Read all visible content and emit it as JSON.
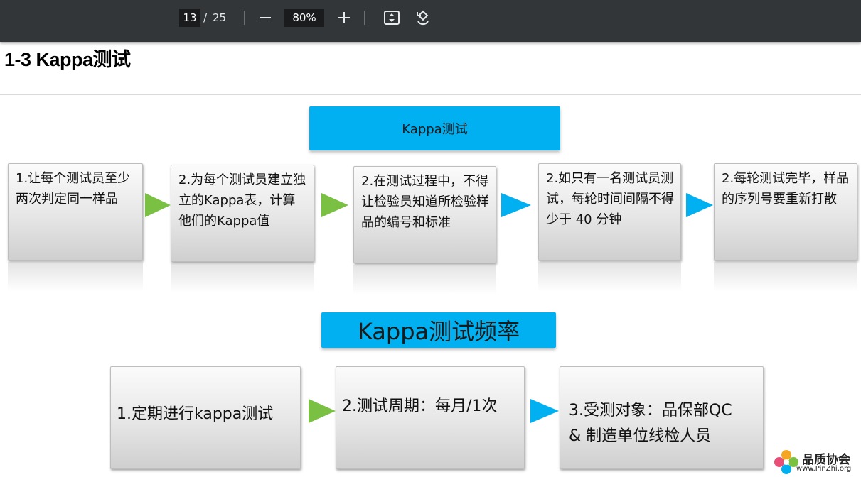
{
  "toolbar": {
    "current_page": "13",
    "separator": "/",
    "total_pages": "25",
    "zoom": "80%",
    "icons": [
      "minus-icon",
      "plus-icon",
      "fit-page-icon",
      "rotate-icon"
    ]
  },
  "slide": {
    "title": "1-3 Kappa测试",
    "section1": {
      "header": "Kappa测试",
      "steps": [
        "1.让每个测试员至少两次判定同一样品",
        "2.为每个测试员建立独立的Kappa表，计算他们的Kappa值",
        "2.在测试过程中，不得让检验员知道所检验样品的编号和标准",
        "2.如只有一名测试员测试，每轮时间间隔不得少于 40 分钟",
        "2.每轮测试完毕，样品的序列号要重新打散"
      ]
    },
    "section2": {
      "header": "Kappa测试频率",
      "steps": [
        "1.定期进行kappa测试",
        "2.测试周期：每月/1次",
        "3.受测对象：品保部QC & 制造单位线检人员"
      ]
    },
    "colors": {
      "header_blue": "#00b0f0",
      "arrow_green": "#7ac143",
      "arrow_blue": "#00b0f0"
    }
  },
  "watermark": {
    "name": "品质协会",
    "url": "www.PinZhi.org"
  }
}
